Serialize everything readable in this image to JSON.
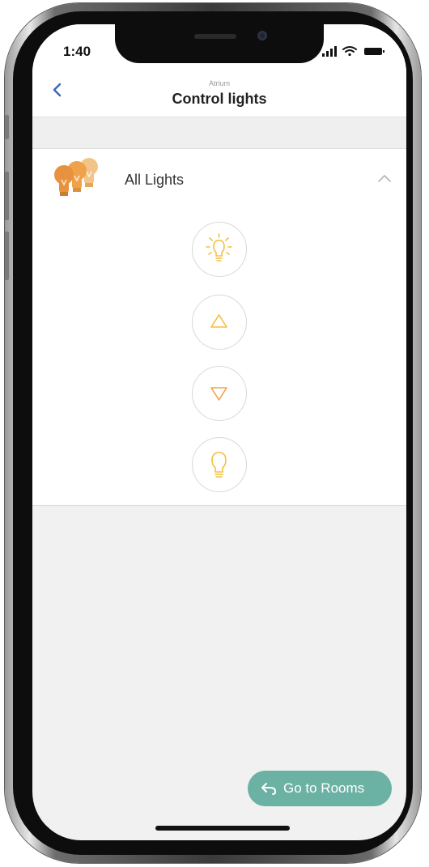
{
  "status_bar": {
    "time": "1:40"
  },
  "nav": {
    "subtitle": "Atrium",
    "title": "Control lights"
  },
  "group": {
    "label": "All Lights",
    "expanded": true,
    "icon": "light-bulbs-icon"
  },
  "controls": [
    {
      "name": "lights-on",
      "icon": "bulb-on-icon"
    },
    {
      "name": "dim-up",
      "icon": "triangle-up-icon"
    },
    {
      "name": "dim-down",
      "icon": "triangle-down-icon"
    },
    {
      "name": "lights-off",
      "icon": "bulb-off-icon"
    }
  ],
  "footer": {
    "go_to_rooms_label": "Go to Rooms"
  },
  "colors": {
    "accent_orange": "#f0a24a",
    "accent_yellow": "#f3c03f",
    "back_blue": "#3a67b8",
    "teal_button": "#6cb2a4"
  }
}
